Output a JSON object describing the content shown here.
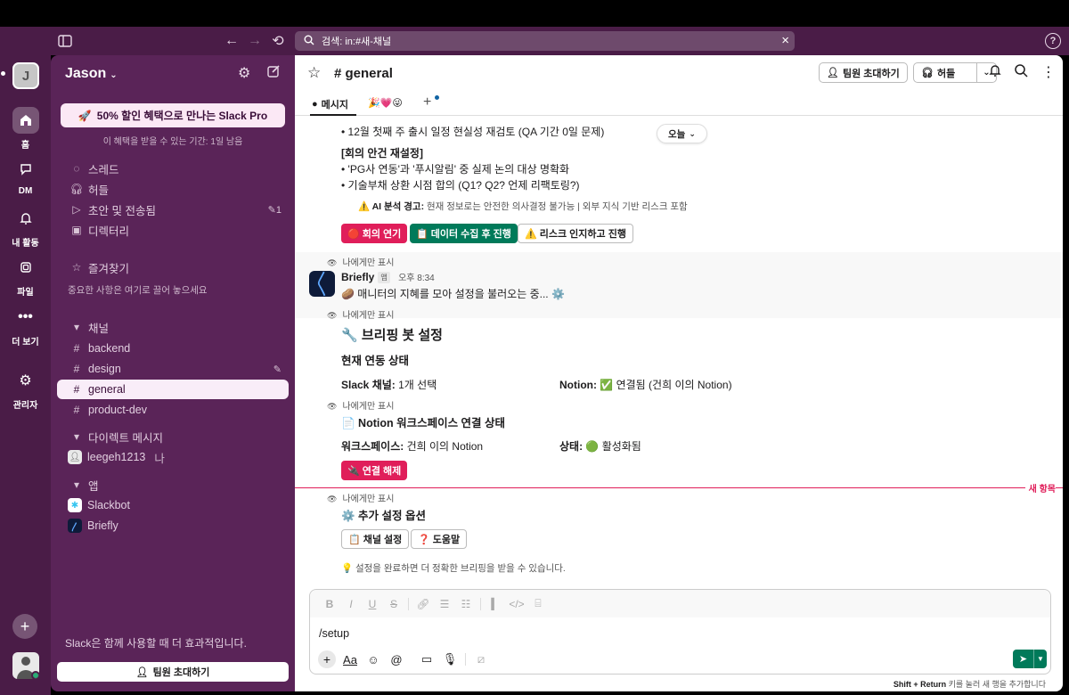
{
  "titlebar": {
    "search_text": "검색: in:#새-채널"
  },
  "rail": {
    "workspace_initial": "J",
    "items": [
      {
        "label": "홈",
        "icon": "home-icon"
      },
      {
        "label": "DM",
        "icon": "dm-icon"
      },
      {
        "label": "내 활동",
        "icon": "bell-icon"
      },
      {
        "label": "파일",
        "icon": "files-icon"
      },
      {
        "label": "더 보기",
        "icon": "more-icon"
      },
      {
        "label": "관리자",
        "icon": "admin-icon"
      }
    ]
  },
  "sidebar": {
    "workspace_name": "Jason",
    "promo_label": "50% 할인 혜택으로 만나는 Slack Pro",
    "promo_sub": "이 혜택을 받을 수 있는 기간: 1일 남음",
    "nav": [
      {
        "label": "스레드"
      },
      {
        "label": "허들"
      },
      {
        "label": "초안 및 전송됨",
        "badge": "1"
      },
      {
        "label": "디렉터리"
      }
    ],
    "favorites_label": "즐겨찾기",
    "favorites_hint": "중요한 사항은 여기로 끌어 놓으세요",
    "channels_header": "채널",
    "channels": [
      "backend",
      "design",
      "general",
      "product-dev"
    ],
    "dm_header": "다이렉트 메시지",
    "dm_user": "leegeh1213",
    "dm_tag": "나",
    "apps_header": "앱",
    "apps": [
      "Slackbot",
      "Briefly"
    ],
    "footer_text": "Slack은 함께 사용할 때 더 효과적입니다.",
    "invite_label": "팀원 초대하기"
  },
  "channel": {
    "name": "general",
    "invite_label": "팀원 초대하기",
    "huddle_label": "허들",
    "tabs": [
      {
        "label": "메시지"
      },
      {
        "label": "🎉💗😜"
      }
    ]
  },
  "messages": {
    "bullet1": "• 12월 첫째 주 출시 일정 현실성 재검토 (QA 기간 0일 문제)",
    "today": "오늘",
    "agenda_title": "[회의 안건 재설정]",
    "bullet2": "• 'PG사 연동'과 '푸시알림' 중 실제 논의 대상 명확화",
    "bullet3": "• 기술부채 상환 시점 합의 (Q1? Q2? 언제 리팩토링?)",
    "warning_label": "⚠️ AI 분석 경고:",
    "warning_text": "현재 정보로는 안전한 의사결정 불가능 | 외부 지식 기반 리스크 포함",
    "btn_postpone": "🔴 회의 연기",
    "btn_collect": "📋 데이터 수집 후 진행",
    "btn_risk": "⚠️ 리스크 인지하고 진행",
    "only_you": "나에게만 표시",
    "bot_name": "Briefly",
    "app_badge": "앱",
    "bot_time": "오후 8:34",
    "loading_text": "🥔 매니터의 지혜를 모아 설정을 불러오는 중... ⚙️",
    "settings_title": "🔧 브리핑 봇 설정",
    "status_title": "현재 연동 상태",
    "slack_channel_label": "Slack 채널:",
    "slack_channel_value": " 1개 선택",
    "notion_label": "Notion:",
    "notion_value": "✅ 연결됨 (건희 이의 Notion)",
    "notion_ws_title": "📄 Notion 워크스페이스 연결 상태",
    "workspace_label": "워크스페이스:",
    "workspace_value": " 건희 이의 Notion",
    "state_label": "상태:",
    "state_value": " 🟢 활성화됨",
    "btn_disconnect": "🔌 연결 해제",
    "new_label": "새 항목",
    "extra_title": "⚙️ 추가 설정 옵션",
    "btn_channel_settings": "📋 채널 설정",
    "btn_help": "❓ 도움말",
    "tip": "💡 설정을 완료하면 더 정확한 브리핑을 받을 수 있습니다."
  },
  "composer": {
    "text": "/setup",
    "hint_pre": "Shift + Return",
    "hint_post": " 키를 눌러 새 행을 추가합니다"
  }
}
